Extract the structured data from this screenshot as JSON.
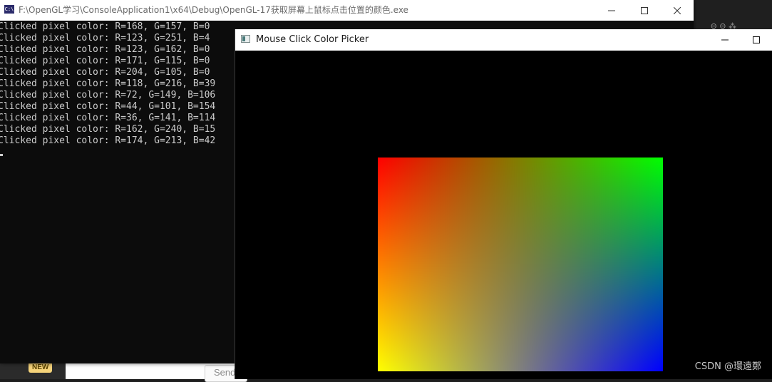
{
  "console_window": {
    "title": "F:\\OpenGL学习\\ConsoleApplication1\\x64\\Debug\\OpenGL-17获取屏幕上鼠标点击位置的颜色.exe",
    "icon_text": "C:\\",
    "output_lines": [
      "Clicked pixel color: R=168, G=157, B=0",
      "Clicked pixel color: R=123, G=251, B=4",
      "Clicked pixel color: R=123, G=162, B=0",
      "Clicked pixel color: R=171, G=115, B=0",
      "Clicked pixel color: R=204, G=105, B=0",
      "Clicked pixel color: R=118, G=216, B=39",
      "Clicked pixel color: R=72, G=149, B=106",
      "Clicked pixel color: R=44, G=101, B=154",
      "Clicked pixel color: R=36, G=141, B=114",
      "Clicked pixel color: R=162, G=240, B=15",
      "Clicked pixel color: R=174, G=213, B=42"
    ]
  },
  "gl_window": {
    "title": "Mouse Click Color Picker",
    "colors": {
      "top_left": "#ff0000",
      "top_right": "#00ff00",
      "bottom_left": "#ffff00",
      "bottom_right": "#0000ff",
      "background": "#000000"
    }
  },
  "background": {
    "new_badge": "NEW",
    "send_button": "Send",
    "watermark": "CSDN @環遠鄭"
  },
  "window_controls": {
    "minimize": "—",
    "maximize": "☐",
    "close": "✕"
  }
}
